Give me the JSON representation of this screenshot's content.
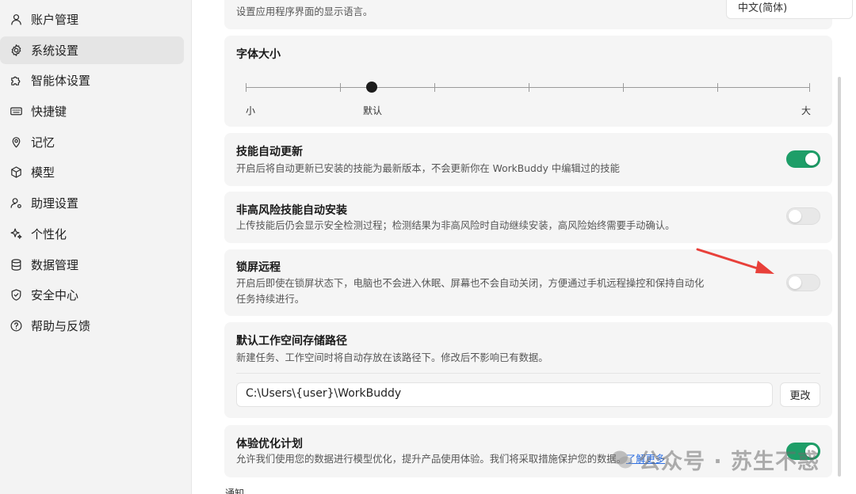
{
  "sidebar": {
    "items": [
      {
        "label": "账户管理",
        "icon": "user-icon"
      },
      {
        "label": "系统设置",
        "icon": "gear-icon",
        "active": true
      },
      {
        "label": "智能体设置",
        "icon": "puzzle-icon"
      },
      {
        "label": "快捷键",
        "icon": "keyboard-icon"
      },
      {
        "label": "记忆",
        "icon": "memory-pin-icon"
      },
      {
        "label": "模型",
        "icon": "cube-icon"
      },
      {
        "label": "助理设置",
        "icon": "assistant-user-icon"
      },
      {
        "label": "个性化",
        "icon": "sparkle-icon"
      },
      {
        "label": "数据管理",
        "icon": "database-icon"
      },
      {
        "label": "安全中心",
        "icon": "shield-icon"
      },
      {
        "label": "帮助与反馈",
        "icon": "help-circle-icon"
      }
    ]
  },
  "settings": {
    "language": {
      "desc": "设置应用程序界面的显示语言。",
      "value": "中文(简体)"
    },
    "font_size": {
      "title": "字体大小",
      "min_label": "小",
      "default_label": "默认",
      "max_label": "大",
      "steps": 7,
      "current_step": 1
    },
    "skill_auto_update": {
      "title": "技能自动更新",
      "desc": "开启后将自动更新已安装的技能为最新版本，不会更新你在 WorkBuddy 中编辑过的技能",
      "enabled": true
    },
    "low_risk_auto_install": {
      "title": "非高风险技能自动安装",
      "desc": "上传技能后仍会显示安全检测过程；检测结果为非高风险时自动继续安装，高风险始终需要手动确认。",
      "enabled": false
    },
    "lock_screen_remote": {
      "title": "锁屏远程",
      "desc": "开启后即使在锁屏状态下，电脑也不会进入休眠、屏幕也不会自动关闭，方便通过手机远程操控和保持自动化任务持续进行。",
      "enabled": false
    },
    "workspace_path": {
      "title": "默认工作空间存储路径",
      "desc": "新建任务、工作空间时将自动存放在该路径下。修改后不影响已有数据。",
      "value": "C:\\Users\\{user}\\WorkBuddy",
      "change_label": "更改"
    },
    "experience_program": {
      "title": "体验优化计划",
      "desc": "允许我们使用您的数据进行模型优化，提升产品使用体验。我们将采取措施保护您的数据。",
      "link": "了解更多",
      "enabled": true
    }
  },
  "next_section": "通知",
  "watermark": "公众号 · 苏生不惑",
  "colors": {
    "accent_green": "#1e9e68",
    "arrow_red": "#e8403a",
    "link_blue": "#2f6fe0"
  }
}
